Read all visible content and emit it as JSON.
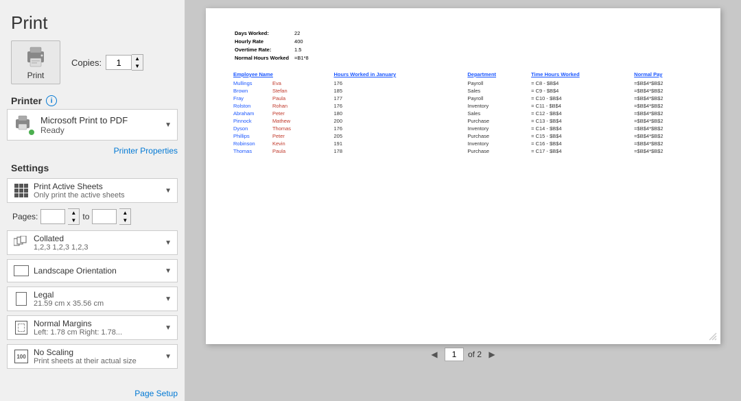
{
  "page": {
    "title": "Print"
  },
  "print_button": {
    "label": "Print"
  },
  "copies": {
    "label": "Copies:",
    "value": "1"
  },
  "printer_section": {
    "label": "Printer",
    "name": "Microsoft Print to PDF",
    "status": "Ready",
    "properties_link": "Printer Properties"
  },
  "settings_section": {
    "label": "Settings",
    "items": [
      {
        "id": "print-active-sheets",
        "main": "Print Active Sheets",
        "sub": "Only print the active sheets"
      },
      {
        "id": "collated",
        "main": "Collated",
        "sub": "1,2,3  1,2,3  1,2,3"
      },
      {
        "id": "landscape",
        "main": "Landscape Orientation",
        "sub": ""
      },
      {
        "id": "legal",
        "main": "Legal",
        "sub": "21.59 cm x 35.56 cm"
      },
      {
        "id": "normal-margins",
        "main": "Normal Margins",
        "sub": "Left: 1.78 cm  Right: 1.78..."
      },
      {
        "id": "no-scaling",
        "main": "No Scaling",
        "sub": "Print sheets at their actual size"
      }
    ],
    "pages_label": "Pages:",
    "pages_to": "to",
    "page_setup_link": "Page Setup"
  },
  "preview": {
    "meta": [
      {
        "label": "Days Worked:",
        "value": "22"
      },
      {
        "label": "Hourly Rate",
        "value": "400"
      },
      {
        "label": "Overtime Rate:",
        "value": "1.5"
      },
      {
        "label": "Normal Hours Worked",
        "value": "=B1*8"
      }
    ],
    "table": {
      "headers": [
        "Employee Name",
        "",
        "Hours Worked in January",
        "Department",
        "Time Hours Worked",
        "",
        "Normal Pay"
      ],
      "rows": [
        [
          "Mullings",
          "Eva",
          "176",
          "Payroll",
          "= C8 - $B$4",
          "",
          "=$B$4*$B$2"
        ],
        [
          "Brown",
          "Stefan",
          "185",
          "Sales",
          "= C9 - $B$4",
          "",
          "=$B$4*$B$2"
        ],
        [
          "Fray",
          "Paula",
          "177",
          "Payroll",
          "= C10 - $B$4",
          "",
          "=$B$4*$B$2"
        ],
        [
          "Rolston",
          "Rohan",
          "176",
          "Inventory",
          "= C11 - $B$4",
          "",
          "=$B$4*$B$2"
        ],
        [
          "Abraham",
          "Peter",
          "180",
          "Sales",
          "= C12 - $B$4",
          "",
          "=$B$4*$B$2"
        ],
        [
          "Pinnock",
          "Mathew",
          "200",
          "Purchase",
          "= C13 - $B$4",
          "",
          "=$B$4*$B$2"
        ],
        [
          "Dyson",
          "Thomas",
          "176",
          "Inventory",
          "= C14 - $B$4",
          "",
          "=$B$4*$B$2"
        ],
        [
          "Phillips",
          "Peter",
          "205",
          "Purchase",
          "= C15 - $B$4",
          "",
          "=$B$4*$B$2"
        ],
        [
          "Robinson",
          "Kevin",
          "191",
          "Inventory",
          "= C16 - $B$4",
          "",
          "=$B$4*$B$2"
        ],
        [
          "Thomas",
          "Paula",
          "178",
          "Purchase",
          "= C17 - $B$4",
          "",
          "=$B$4*$B$2"
        ]
      ]
    }
  },
  "navigation": {
    "current_page": "1",
    "of_label": "of 2"
  }
}
